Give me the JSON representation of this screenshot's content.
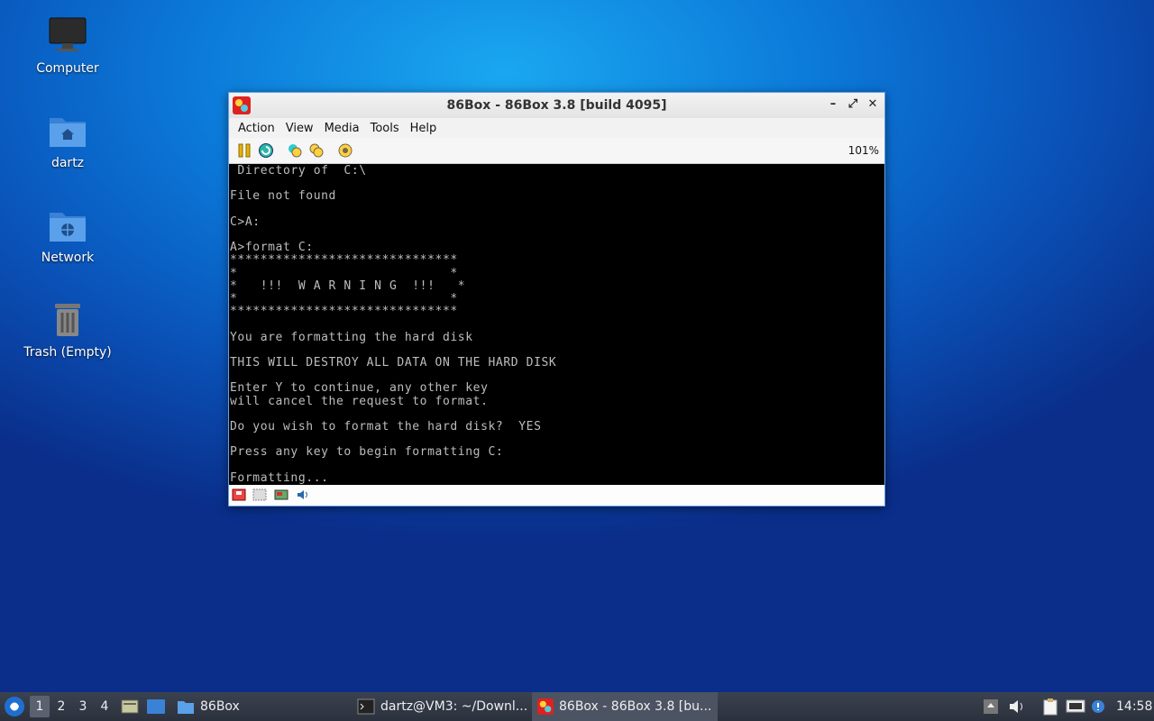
{
  "desktop": {
    "icons": [
      {
        "label": "Computer",
        "icon": "computer-icon"
      },
      {
        "label": "dartz",
        "icon": "home-folder-icon"
      },
      {
        "label": "Network",
        "icon": "network-folder-icon"
      },
      {
        "label": "Trash (Empty)",
        "icon": "trash-icon"
      }
    ]
  },
  "window": {
    "title": "86Box - 86Box 3.8 [build 4095]",
    "menu": [
      "Action",
      "View",
      "Media",
      "Tools",
      "Help"
    ],
    "zoom": "101%",
    "screen_lines": [
      " Directory of  C:\\",
      "",
      "File not found",
      "",
      "C>A:",
      "",
      "A>format C:",
      "******************************",
      "*                            *",
      "*   !!!  W A R N I N G  !!!   *",
      "*                            *",
      "******************************",
      "",
      "You are formatting the hard disk",
      "",
      "THIS WILL DESTROY ALL DATA ON THE HARD DISK",
      "",
      "Enter Y to continue, any other key",
      "will cancel the request to format.",
      "",
      "Do you wish to format the hard disk?  YES",
      "",
      "Press any key to begin formatting C:",
      "",
      "Formatting..."
    ]
  },
  "taskbar": {
    "workspaces": [
      "1",
      "2",
      "3",
      "4"
    ],
    "launcher_label": "86Box",
    "tasks": [
      {
        "label": "dartz@VM3: ~/Downl...",
        "active": false
      },
      {
        "label": "86Box - 86Box 3.8 [bu...",
        "active": true
      }
    ],
    "clock": "14:58"
  }
}
